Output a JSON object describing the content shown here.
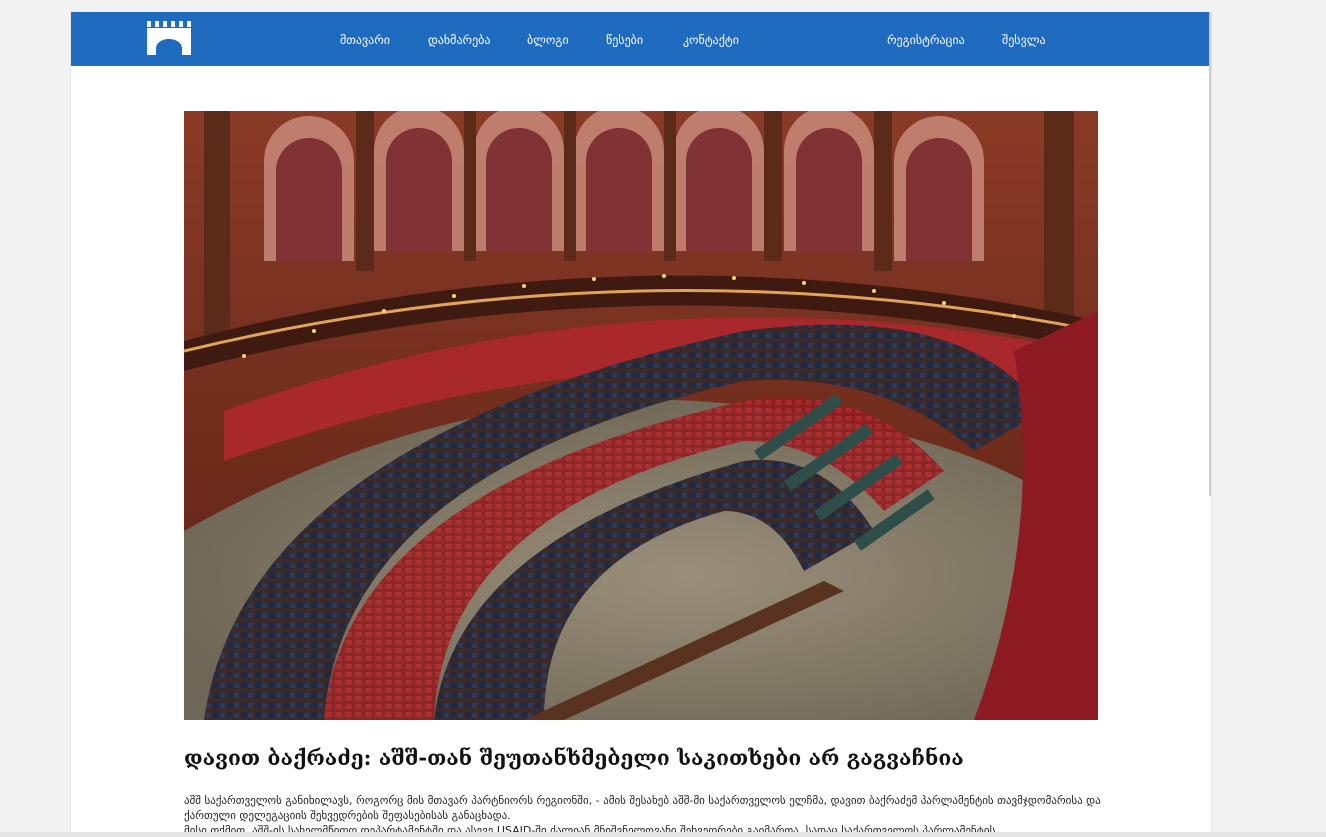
{
  "header": {
    "logo_icon": "bridge-icon",
    "accent_color": "#1e6bc0",
    "nav": {
      "home": "მთავარი",
      "help": "დახმარება",
      "blog": "ბლოგი",
      "rules": "წესები",
      "contact": "კონტაქტი",
      "register": "რეგისტრაცია",
      "login": "შესვლა"
    }
  },
  "article": {
    "image_icon": "parliament-chamber-photo",
    "title": "დავით ბაქრაძე: აშშ-თან შეუთანხმებელი საკითხები არ გაგვაჩნია",
    "paragraph_1": "აშშ საქართველოს განიხილავს, როგორც მის მთავარ პარტნიორს რეგიონში, - ამის შესახებ აშშ-ში საქართველოს ელჩმა, დავით ბაქრაძემ პარლამენტის თავმჯდომარისა და ქართული დელეგაციის შეხვედრების შეფასებისას განაცხადა.",
    "paragraph_2": "მისი თქმით, აშშ-ის სახელმწიფო დეპარტამენტში და ასევე USAID-ში ძალიან მნიშვნელოვანი შეხვედრები გაიმართა, სადაც საქართველოს პარლამენტის"
  }
}
